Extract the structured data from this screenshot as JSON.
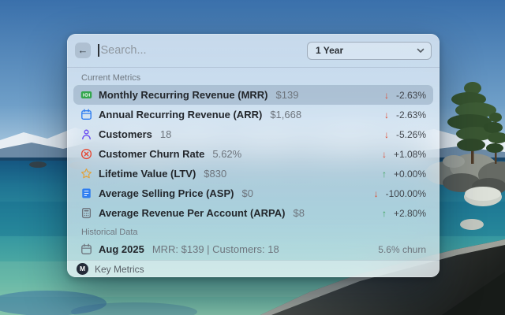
{
  "window": {
    "header": {
      "back_glyph": "←",
      "search_placeholder": "Search...",
      "dropdown_value": "1 Year"
    },
    "sections": [
      {
        "label": "Current Metrics",
        "items": [
          {
            "icon": "banknote-icon",
            "title": "Monthly Recurring Revenue (MRR)",
            "value": "$139",
            "direction": "down",
            "change": "-2.63%",
            "selected": true
          },
          {
            "icon": "calendar-blue-icon",
            "title": "Annual Recurring Revenue (ARR)",
            "value": "$1,668",
            "direction": "down",
            "change": "-2.63%"
          },
          {
            "icon": "person-icon",
            "title": "Customers",
            "value": "18",
            "direction": "down",
            "change": "-5.26%"
          },
          {
            "icon": "x-circle-icon",
            "title": "Customer Churn Rate",
            "value": "5.62%",
            "direction": "down",
            "change": "+1.08%"
          },
          {
            "icon": "star-icon",
            "title": "Lifetime Value (LTV)",
            "value": "$830",
            "direction": "up",
            "change": "+0.00%"
          },
          {
            "icon": "document-icon",
            "title": "Average Selling Price (ASP)",
            "value": "$0",
            "direction": "down",
            "change": "-100.00%"
          },
          {
            "icon": "calculator-icon",
            "title": "Average Revenue Per Account (ARPA)",
            "value": "$8",
            "direction": "up",
            "change": "+2.80%"
          }
        ]
      },
      {
        "label": "Historical Data",
        "items": [
          {
            "icon": "calendar-gray-icon",
            "title": "Aug 2025",
            "value": "MRR: $139 | Customers: 18",
            "accessory": "5.6% churn"
          }
        ]
      }
    ],
    "footer": {
      "app_name": "Key Metrics",
      "logo_letter": "M"
    }
  },
  "colors": {
    "negative": "#e04a30",
    "positive": "#3da25b",
    "trend_down_glyph": "↓",
    "trend_up_glyph": "↑"
  }
}
